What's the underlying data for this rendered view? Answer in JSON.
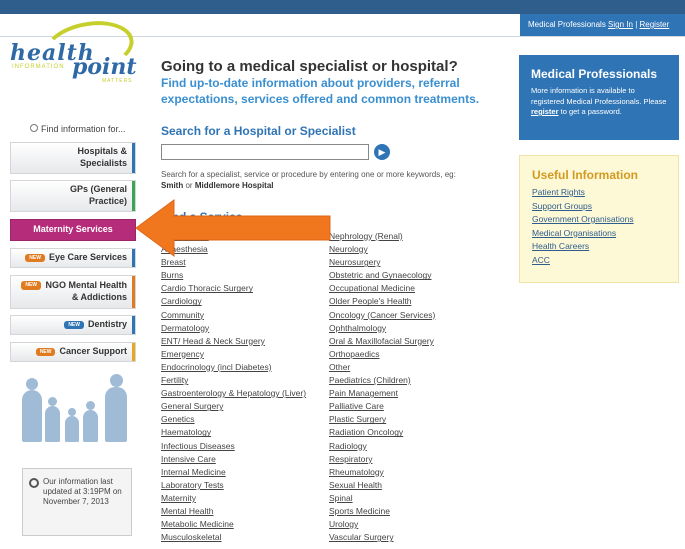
{
  "header": {
    "label": "Medical Professionals",
    "sign_in": "Sign In",
    "register": "Register"
  },
  "logo": {
    "word1": "health",
    "tag1": "INFORMATION",
    "word2": "point",
    "tag2": "MATTERS"
  },
  "sidebar": {
    "find_label": "Find information for...",
    "items": [
      {
        "label": "Hospitals & Specialists"
      },
      {
        "label": "GPs (General Practice)"
      },
      {
        "label": "Maternity Services"
      },
      {
        "label": "Eye Care Services",
        "badge": "NEW"
      },
      {
        "label": "NGO Mental Health & Addictions",
        "badge": "NEW"
      },
      {
        "label": "Dentistry",
        "badge": "NEW"
      },
      {
        "label": "Cancer Support",
        "badge": "NEW"
      }
    ],
    "updated_text": "Our information last updated at 3:19PM on November 7, 2013"
  },
  "main": {
    "headline": "Going to a medical specialist or hospital?",
    "subhead": "Find up-to-date information about providers, referral expectations, services offered and common treatments.",
    "search_title": "Search for a Hospital or Specialist",
    "search_value": "",
    "search_help_prefix": "Search for a specialist, service or procedure by entering one or more keywords, eg:",
    "search_help_eg1": "Smith",
    "search_help_or": "or",
    "search_help_eg2": "Middlemore Hospital",
    "find_service": "Find a Service",
    "services_col1": [
      "Allied Health",
      "Anaesthesia",
      "Breast",
      "Burns",
      "Cardio Thoracic Surgery",
      "Cardiology",
      "Community",
      "Dermatology",
      "ENT/ Head & Neck Surgery",
      "Emergency",
      "Endocrinology (incl Diabetes)",
      "Fertility",
      "Gastroenterology & Hepatology (Liver)",
      "General Surgery",
      "Genetics",
      "Haematology",
      "Infectious Diseases",
      "Intensive Care",
      "Internal Medicine",
      "Laboratory Tests",
      "Maternity",
      "Mental Health",
      "Metabolic Medicine",
      "Musculoskeletal"
    ],
    "services_col2": [
      "Nephrology (Renal)",
      "Neurology",
      "Neurosurgery",
      "Obstetric and Gynaecology",
      "Occupational Medicine",
      "Older People's Health",
      "Oncology (Cancer Services)",
      "Ophthalmology",
      "Oral & Maxillofacial Surgery",
      "Orthopaedics",
      "Other",
      "Paediatrics (Children)",
      "Pain Management",
      "Palliative Care",
      "Plastic Surgery",
      "Radiation Oncology",
      "Radiology",
      "Respiratory",
      "Rheumatology",
      "Sexual Health",
      "Spinal",
      "Sports Medicine",
      "Urology",
      "Vascular Surgery"
    ]
  },
  "medpro": {
    "title": "Medical Professionals",
    "line1": "More information is available to registered Medical Professionals. Please",
    "register": "register",
    "line2": "to get a password."
  },
  "useful": {
    "title": "Useful Information",
    "links": [
      "Patient Rights",
      "Support Groups",
      "Government Organisations",
      "Medical Organisations",
      "Health Careers",
      "ACC"
    ]
  },
  "colors": {
    "brand_blue": "#2f74b5",
    "maternity": "#b52c7a",
    "arrow": "#f0771d"
  }
}
